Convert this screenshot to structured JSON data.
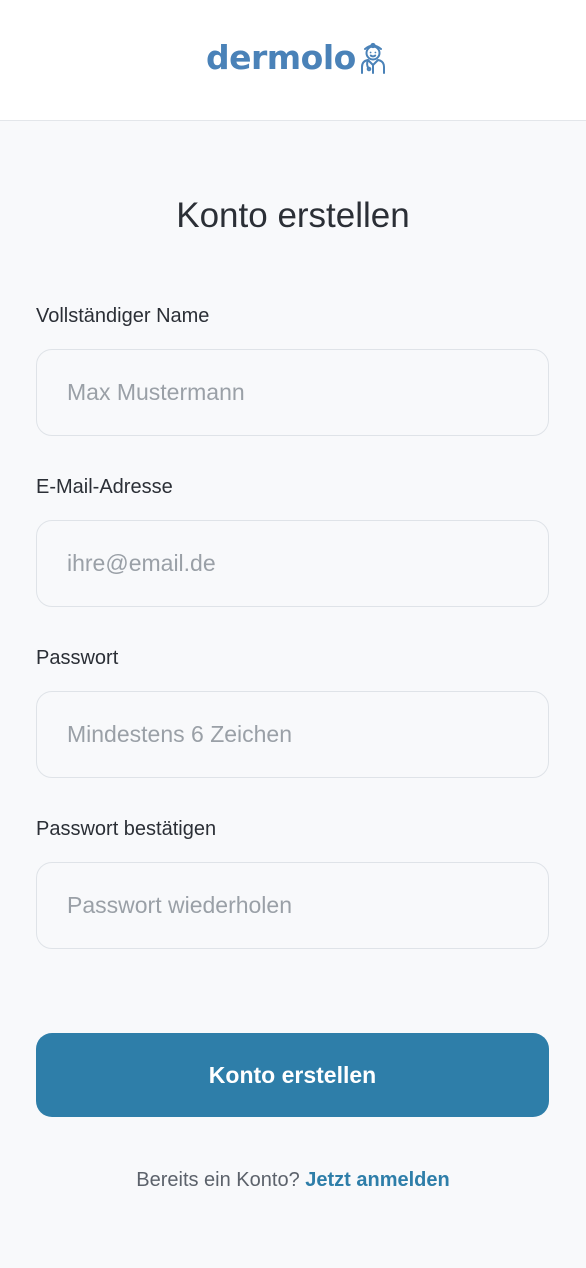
{
  "header": {
    "logo_text": "dermolo",
    "logo_icon": "doctor-mascot-icon",
    "brand_color": "#4a82b8"
  },
  "page": {
    "title": "Konto erstellen"
  },
  "form": {
    "name": {
      "label": "Vollständiger Name",
      "placeholder": "Max Mustermann",
      "value": ""
    },
    "email": {
      "label": "E-Mail-Adresse",
      "placeholder": "ihre@email.de",
      "value": ""
    },
    "password": {
      "label": "Passwort",
      "placeholder": "Mindestens 6 Zeichen",
      "value": ""
    },
    "password_confirm": {
      "label": "Passwort bestätigen",
      "placeholder": "Passwort wiederholen",
      "value": ""
    },
    "submit_label": "Konto erstellen",
    "accent_color": "#2e7ea9"
  },
  "footer": {
    "prompt": "Bereits ein Konto?",
    "login_link": "Jetzt anmelden"
  }
}
